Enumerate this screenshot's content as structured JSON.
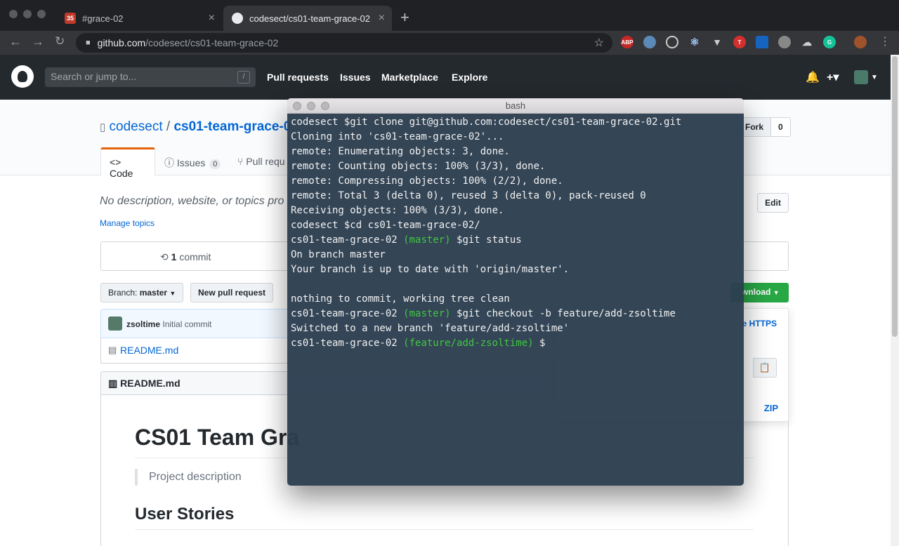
{
  "browser": {
    "tabs": [
      {
        "title": "#grace-02",
        "favicon_text": "35",
        "active": false
      },
      {
        "title": "codesect/cs01-team-grace-02",
        "active": true
      }
    ],
    "new_tab": "+",
    "url_host": "github.com",
    "url_path": "/codesect/cs01-team-grace-02",
    "ext_abp": "ABP"
  },
  "github": {
    "search_placeholder": "Search or jump to...",
    "search_key": "/",
    "nav": [
      "Pull requests",
      "Issues",
      "Marketplace",
      "Explore"
    ],
    "repo_owner": "codesect",
    "repo_sep": "/",
    "repo_name": "cs01-team-grace-0",
    "fork_label": "Fork",
    "fork_count": "0",
    "tabs": {
      "code": "Code",
      "issues": "Issues",
      "issues_count": "0",
      "pulls": "Pull requ"
    },
    "description": "No description, website, or topics pro",
    "manage_topics": "Manage topics",
    "edit": "Edit",
    "commit_count": "1",
    "commit_word": "commit",
    "branch_label": "Branch: ",
    "branch_name": "master",
    "new_pr": "New pull request",
    "download": "wnload",
    "commit_author": "zsoltime",
    "commit_msg": "Initial commit",
    "file_name": "README.md",
    "readme_label": "README.md",
    "readme_h1": "CS01 Team Gra",
    "readme_quote": "Project description",
    "readme_h2": "User Stories",
    "clone_https": "e HTTPS",
    "clone_zip": "ZIP"
  },
  "terminal": {
    "title": "bash",
    "lines": [
      {
        "prefix": "codesect $git clone git@github.com:codesect/cs01-team-grace-02.git",
        "branch": "",
        "suffix": ""
      },
      {
        "prefix": "Cloning into 'cs01-team-grace-02'...",
        "branch": "",
        "suffix": ""
      },
      {
        "prefix": "remote: Enumerating objects: 3, done.",
        "branch": "",
        "suffix": ""
      },
      {
        "prefix": "remote: Counting objects: 100% (3/3), done.",
        "branch": "",
        "suffix": ""
      },
      {
        "prefix": "remote: Compressing objects: 100% (2/2), done.",
        "branch": "",
        "suffix": ""
      },
      {
        "prefix": "remote: Total 3 (delta 0), reused 3 (delta 0), pack-reused 0",
        "branch": "",
        "suffix": ""
      },
      {
        "prefix": "Receiving objects: 100% (3/3), done.",
        "branch": "",
        "suffix": ""
      },
      {
        "prefix": "codesect $cd cs01-team-grace-02/",
        "branch": "",
        "suffix": ""
      },
      {
        "prefix": "cs01-team-grace-02 ",
        "branch": "(master)",
        "suffix": " $git status"
      },
      {
        "prefix": "On branch master",
        "branch": "",
        "suffix": ""
      },
      {
        "prefix": "Your branch is up to date with 'origin/master'.",
        "branch": "",
        "suffix": ""
      },
      {
        "prefix": "",
        "branch": "",
        "suffix": ""
      },
      {
        "prefix": "nothing to commit, working tree clean",
        "branch": "",
        "suffix": ""
      },
      {
        "prefix": "cs01-team-grace-02 ",
        "branch": "(master)",
        "suffix": " $git checkout -b feature/add-zsoltime"
      },
      {
        "prefix": "Switched to a new branch 'feature/add-zsoltime'",
        "branch": "",
        "suffix": ""
      },
      {
        "prefix": "cs01-team-grace-02 ",
        "branch": "(feature/add-zsoltime)",
        "suffix": " $"
      }
    ]
  },
  "colors": {
    "prompt_branch": "#39c63b",
    "terminal_bg": "#2c3e50",
    "github_header": "#24292e",
    "link": "#0366d6",
    "download_button": "#28a745"
  }
}
